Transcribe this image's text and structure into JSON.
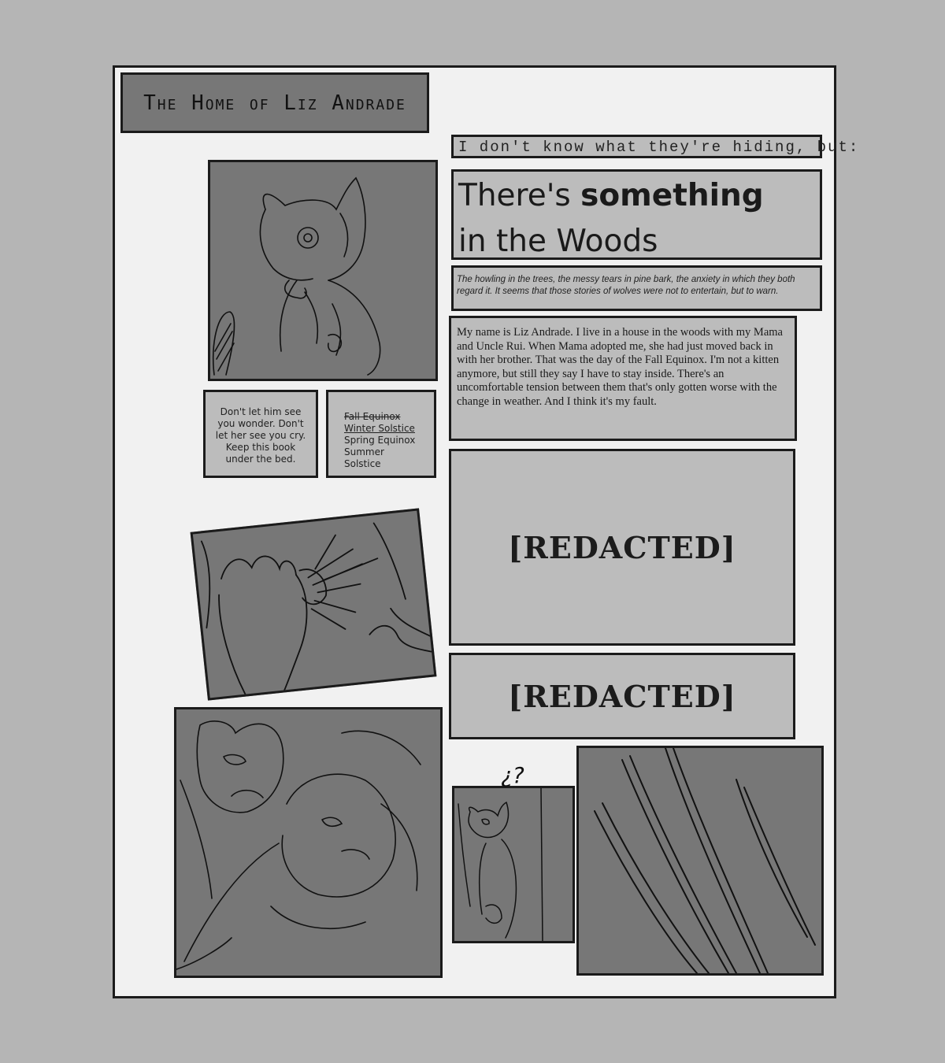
{
  "page": {
    "title": "The Home of Liz Andrade"
  },
  "tagline": "I don't know what they're hiding, but:",
  "headline": {
    "line1_light": "There's ",
    "line1_bold": "something",
    "line2": "in the Woods"
  },
  "subtitle": "The howling in the trees, the messy tears in pine bark, the anxiety in which they both regard it. It seems that those stories of wolves were not to entertain, but to warn.",
  "story": "My name is Liz Andrade. I live in a house in the woods with my Mama and Uncle Rui. When Mama adopted me, she had just moved back in with her brother. That was the day of the Fall Equinox. I'm not a kitten anymore, but still they say I have to stay inside. There's an uncomfortable tension between them that's only gotten worse with the change in weather. And I think it's my fault.",
  "note": "Don't let him see you wonder. Don't let her see you cry. Keep this book under the bed.",
  "seasons": [
    {
      "label": "Fall Equinox",
      "style": "strikethrough"
    },
    {
      "label": "Winter Solstice",
      "style": "underline"
    },
    {
      "label": "Spring Equinox",
      "style": "plain"
    },
    {
      "label": "Summer Solstice",
      "style": "plain"
    }
  ],
  "redacted": {
    "block1": "[REDACTED]",
    "block2": "[REDACTED]"
  },
  "marks": {
    "question": "¿?"
  },
  "colors": {
    "background": "#b5b5b5",
    "page": "#f1f1f1",
    "panel_dark": "#777777",
    "panel_light": "#bcbcbc",
    "ink": "#1b1b1b"
  }
}
